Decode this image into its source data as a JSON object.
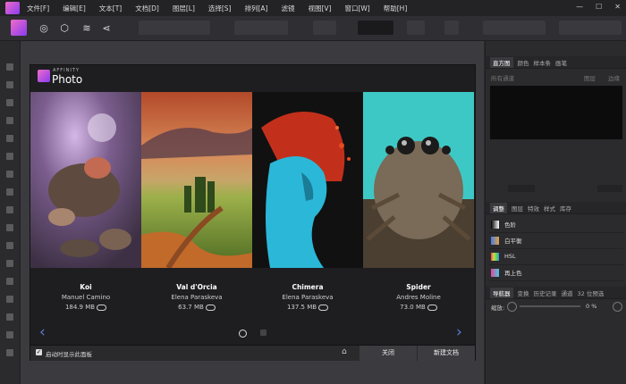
{
  "menubar": {
    "items": [
      "文件[F]",
      "编辑[E]",
      "文本[T]",
      "文档[D]",
      "图层[L]",
      "选择[S]",
      "排列[A]",
      "滤镜",
      "视图[V]",
      "窗口[W]",
      "帮助[H]"
    ],
    "win_min": "—",
    "win_max": "☐",
    "win_close": "✕"
  },
  "toolbar": {
    "personas": [
      "photo-persona",
      "liquify-persona",
      "develop-persona",
      "tone-mapping-persona",
      "export-persona"
    ]
  },
  "dialog": {
    "brand_small": "AFFINITY",
    "brand_title": "Photo",
    "cards": [
      {
        "title": "Koi",
        "author": "Manuel Camino",
        "size": "184.9 MB"
      },
      {
        "title": "Val d'Orcia",
        "author": "Elena Paraskeva",
        "size": "63.7 MB"
      },
      {
        "title": "Chimera",
        "author": "Elena Paraskeva",
        "size": "137.5 MB"
      },
      {
        "title": "Spider",
        "author": "Andres Moline",
        "size": "73.0 MB"
      }
    ],
    "prev_arrow": "‹",
    "next_arrow": "›",
    "show_on_startup": "启动时显示此面板",
    "close_label": "关闭",
    "new_doc_label": "新建文档",
    "home_icon": "⌂"
  },
  "right_panel": {
    "top_tabs": [
      "直方图",
      "颜色",
      "样本条",
      "画笔"
    ],
    "channel_select": "所有通道",
    "layer_opt": "图层",
    "warn_opt": "边缘",
    "mid_tabs": [
      "调整",
      "图层",
      "特效",
      "样式",
      "库存"
    ],
    "adjustments": [
      "色阶",
      "白平衡",
      "HSL",
      "再上色"
    ],
    "bottom_tabs": [
      "导航器",
      "变换",
      "历史记录",
      "通道",
      "32 位预选"
    ],
    "zoom_label": "缩放:",
    "zoom_value": "0 %"
  },
  "colors": {
    "accent_purple": "#9a4cf0",
    "arrow_blue": "#5d7fd1"
  }
}
